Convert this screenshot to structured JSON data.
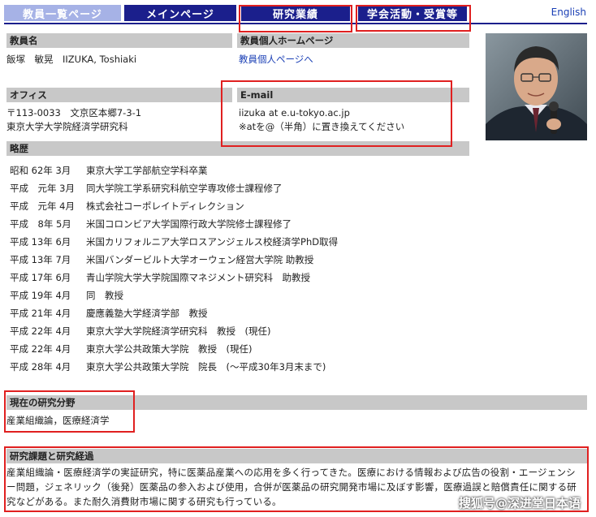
{
  "nav": {
    "faculty_list": "教員一覧ページ",
    "main_page": "メインページ",
    "research": "研究業績",
    "academic": "学会活動・受賞等",
    "english": "English"
  },
  "profile": {
    "name_header": "教員名",
    "name_value": "飯塚　敏晃　IIZUKA, Toshiaki",
    "homepage_header": "教員個人ホームページ",
    "homepage_link": "教員個人ページへ",
    "office_header": "オフィス",
    "office_line1": "〒113-0033　文京区本郷7-3-1",
    "office_line2": "東京大学大学院経済学研究科",
    "email_header": "E-mail",
    "email_line1": "iizuka at e.u-tokyo.ac.jp",
    "email_line2": "※atを@（半角）に置き換えてください"
  },
  "career": {
    "header": "略歴",
    "rows": [
      {
        "date": "昭和 62年 3月",
        "text": "東京大学工学部航空学科卒業"
      },
      {
        "date": "平成　元年 3月",
        "text": "同大学院工学系研究科航空学専攻修士課程修了"
      },
      {
        "date": "平成　元年 4月",
        "text": "株式会社コーポレイトディレクション"
      },
      {
        "date": "平成　8年 5月",
        "text": "米国コロンビア大学国際行政大学院修士課程修了"
      },
      {
        "date": "平成 13年 6月",
        "text": "米国カリフォルニア大学ロスアンジェルス校経済学PhD取得"
      },
      {
        "date": "平成 13年 7月",
        "text": "米国バンダービルト大学オーウェン経営大学院 助教授"
      },
      {
        "date": "平成 17年 6月",
        "text": "青山学院大学大学院国際マネジメント研究科　助教授"
      },
      {
        "date": "平成 19年 4月",
        "text": "同　教授"
      },
      {
        "date": "平成 21年 4月",
        "text": "慶應義塾大学経済学部　教授"
      },
      {
        "date": "平成 22年 4月",
        "text": "東京大学大学院経済学研究科　教授　(現任)"
      },
      {
        "date": "平成 22年 4月",
        "text": "東京大学公共政策大学院　教授　(現任)"
      },
      {
        "date": "平成 28年 4月",
        "text": "東京大学公共政策大学院　院長　(～平成30年3月末まで)"
      }
    ]
  },
  "field": {
    "header": "現在の研究分野",
    "value": "産業組織論，医療経済学"
  },
  "research": {
    "header": "研究課題と研究経過",
    "summary": "産業組織論・医療経済学の実証研究，特に医薬品産業への応用を多く行ってきた。医療における情報および広告の役割・エージェンシー問題，ジェネリック（後発）医薬品の参入および使用，合併が医薬品の研究開発市場に及ぼす影響，医療過誤と賠償責任に関する研究などがある。また耐久消費財市場に関する研究も行っている。"
  },
  "watermark": "搜狐号@深进堂日本语",
  "colors": {
    "nav_dark": "#1b1f8c",
    "nav_light": "#a6b2e6",
    "header_gray": "#c8c8c8",
    "link_blue": "#1a3fb5",
    "highlight_red": "#e02020"
  }
}
